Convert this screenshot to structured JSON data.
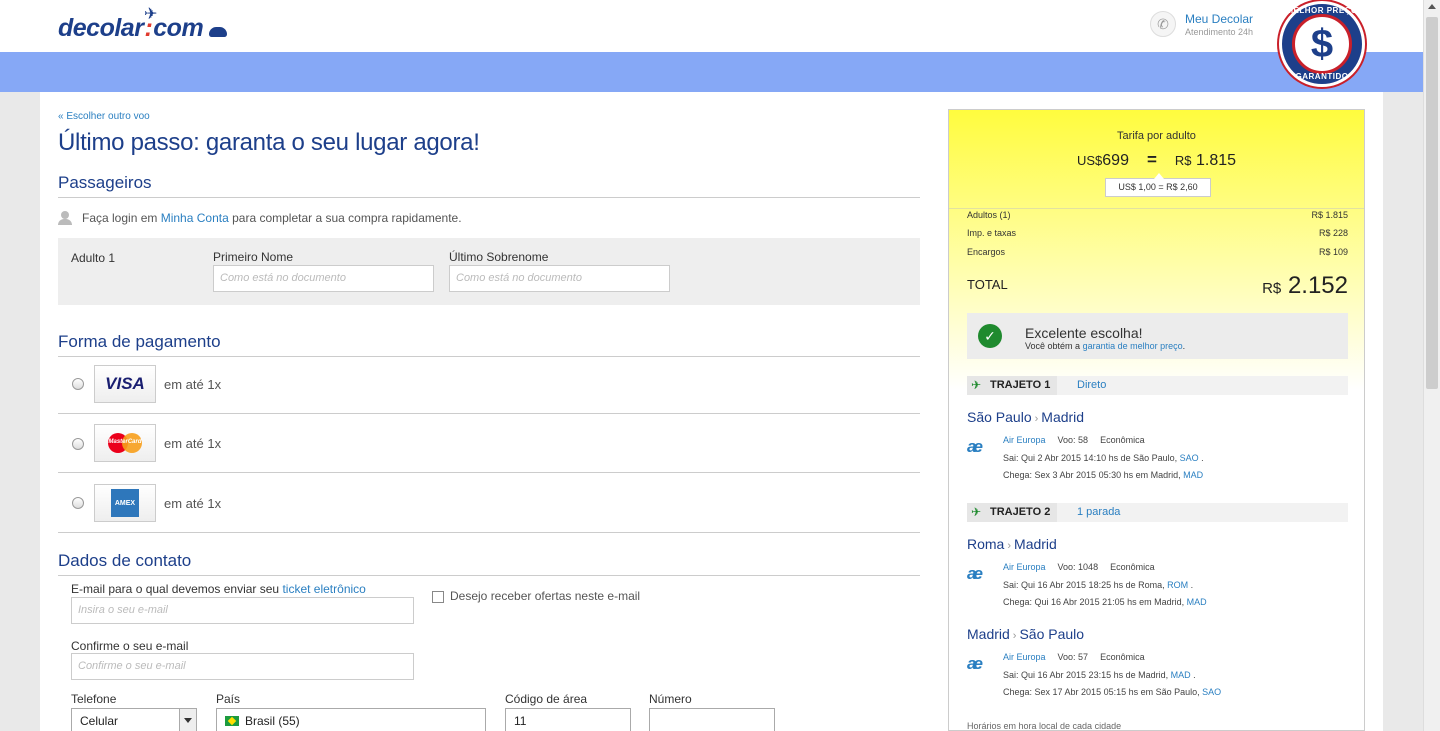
{
  "header": {
    "logo_main": "decolar",
    "logo_colon": ":",
    "logo_com": "com",
    "account_title": "Meu Decolar",
    "account_subtitle": "Atendimento 24h",
    "badge_top": "MELHOR PREÇO",
    "badge_symbol": "$",
    "badge_bottom": "GARANTIDO"
  },
  "form": {
    "back_link": "« Escolher outro voo",
    "title": "Último passo: garanta o seu lugar agora!",
    "passengers": {
      "section_title": "Passageiros",
      "login_prefix": "Faça login em",
      "login_link": "Minha Conta",
      "login_suffix": "para completar a sua compra rapidamente.",
      "adult_label": "Adulto 1",
      "first_name_label": "Primeiro Nome",
      "first_name_placeholder": "Como está no documento",
      "last_name_label": "Último Sobrenome",
      "last_name_placeholder": "Como está no documento"
    },
    "payment": {
      "section_title": "Forma de pagamento",
      "options": [
        {
          "card": "VISA",
          "installments": "em até 1x"
        },
        {
          "card": "MasterCard",
          "installments": "em até 1x"
        },
        {
          "card": "AMEX",
          "installments": "em até 1x"
        }
      ]
    },
    "contact": {
      "section_title": "Dados de contato",
      "email_label_prefix": "E-mail para o qual devemos enviar seu",
      "email_label_link": "ticket eletrônico",
      "email_placeholder": "Insira o seu e-mail",
      "offers_label": "Desejo receber ofertas neste e-mail",
      "confirm_label": "Confirme o seu e-mail",
      "confirm_placeholder": "Confirme o seu e-mail",
      "phone_label": "Telefone",
      "phone_value": "Celular",
      "country_label": "País",
      "country_value": "Brasil (55)",
      "area_label": "Código de área",
      "area_value": "11",
      "number_label": "Número",
      "number_value": ""
    }
  },
  "summary": {
    "tarifa_label": "Tarifa por adulto",
    "usd_cur": "US$",
    "usd_value": "699",
    "equals": "=",
    "brl_cur": "R$",
    "brl_value": "1.815",
    "rate": "US$ 1,00 = R$ 2,60",
    "fees": [
      {
        "label": "Adultos (1)",
        "value": "R$ 1.815"
      },
      {
        "label": "Imp. e taxas",
        "value": "R$ 228"
      },
      {
        "label": "Encargos",
        "value": "R$ 109"
      }
    ],
    "total_label": "TOTAL",
    "total_cur": "R$",
    "total_value": "2.152",
    "excellent_title": "Excelente escolha!",
    "excellent_prefix": "Você obtém a",
    "excellent_link": "garantia de melhor preço",
    "excellent_suffix": ".",
    "footnote": "Horários em hora local de cada cidade"
  },
  "trajetos": [
    {
      "name": "TRAJETO 1",
      "type": "Direto",
      "route_from": "São Paulo",
      "route_to": "Madrid",
      "airline": "Air Europa",
      "flight": "Voo: 58",
      "class": "Econômica",
      "depart_text": "Sai: Qui 2 Abr 2015 14:10 hs de São Paulo,",
      "depart_code": "SAO",
      "arrive_text": "Chega: Sex 3 Abr 2015 05:30 hs em Madrid,",
      "arrive_code": "MAD"
    },
    {
      "name": "TRAJETO 2",
      "type": "1 parada",
      "route_from": "Roma",
      "route_to": "Madrid",
      "airline": "Air Europa",
      "flight": "Voo: 1048",
      "class": "Econômica",
      "depart_text": "Sai: Qui 16 Abr 2015 18:25 hs de Roma,",
      "depart_code": "ROM",
      "arrive_text": "Chega: Qui 16 Abr 2015 21:05 hs em Madrid,",
      "arrive_code": "MAD"
    },
    {
      "route_from": "Madrid",
      "route_to": "São Paulo",
      "airline": "Air Europa",
      "flight": "Voo: 57",
      "class": "Econômica",
      "depart_text": "Sai: Qui 16 Abr 2015 23:15 hs de Madrid,",
      "depart_code": "MAD",
      "arrive_text": "Chega: Sex 17 Abr 2015 05:15 hs em São Paulo,",
      "arrive_code": "SAO"
    }
  ]
}
